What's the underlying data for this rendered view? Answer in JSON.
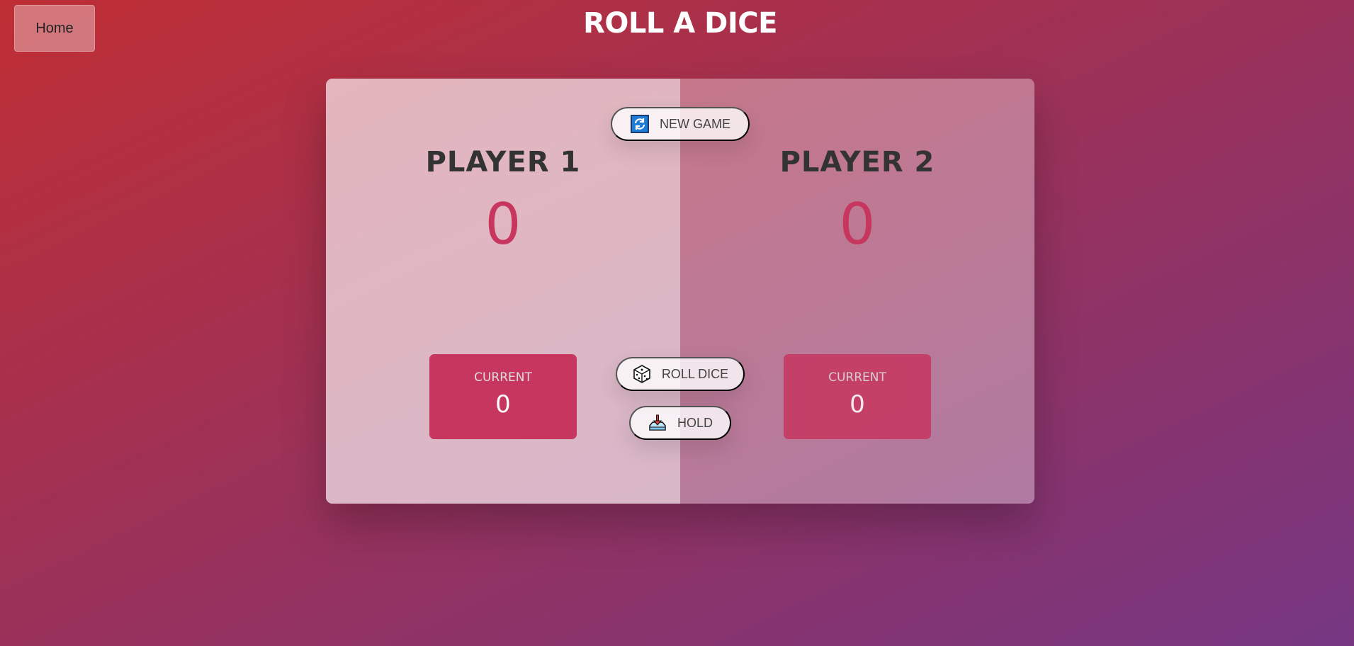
{
  "nav": {
    "home_label": "Home"
  },
  "header": {
    "title": "ROLL A DICE"
  },
  "players": [
    {
      "name": "PLAYER 1",
      "score": "0",
      "current_label": "CURRENT",
      "current_score": "0",
      "active": true
    },
    {
      "name": "PLAYER 2",
      "score": "0",
      "current_label": "CURRENT",
      "current_score": "0",
      "active": false
    }
  ],
  "controls": {
    "new_game": {
      "label": "NEW GAME",
      "icon": "refresh-icon"
    },
    "roll_dice": {
      "label": "ROLL DICE",
      "icon": "dice-icon"
    },
    "hold": {
      "label": "HOLD",
      "icon": "hold-icon"
    }
  },
  "colors": {
    "accent": "#c7365f",
    "bg_start": "#bf2e34",
    "bg_end": "#753682"
  }
}
